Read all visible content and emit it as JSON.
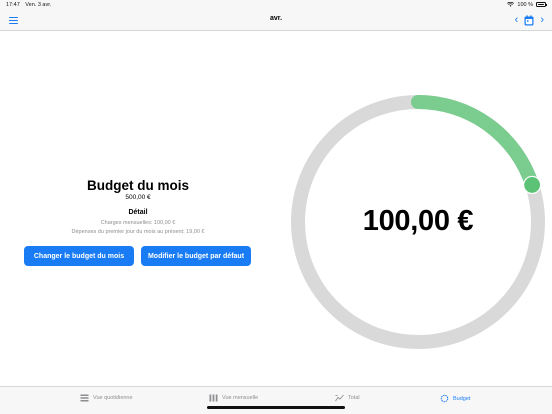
{
  "status_bar": {
    "time": "17:47",
    "date": "Ven. 3 avr.",
    "battery_text": "100 %"
  },
  "nav": {
    "title": "avr.",
    "prev_label": "‹",
    "next_label": "›"
  },
  "budget": {
    "title": "Budget du mois",
    "amount": "500,00 €",
    "detail_title": "Détail",
    "charges_line": "Charges mensuelles: 100,00 €",
    "expenses_line": "Dépenses du premier jour du mois au présent: 19,00 €",
    "change_button": "Changer le budget du mois",
    "default_button": "Modifier le budget par défaut"
  },
  "ring": {
    "value_text": "100,00 €",
    "progress_fraction": 0.2,
    "track_color": "#d9d9d9",
    "progress_color": "#7acd8f",
    "knob_color": "#5cc275"
  },
  "tabs": [
    {
      "label": "Vue quotidienne",
      "icon": "daily-view-icon"
    },
    {
      "label": "Vue mensuelle",
      "icon": "monthly-view-icon"
    },
    {
      "label": "Total",
      "icon": "total-chart-icon"
    },
    {
      "label": "Budget",
      "icon": "budget-ring-icon"
    }
  ],
  "colors": {
    "accent": "#1a7cf5",
    "inactive": "#8e8e93"
  }
}
